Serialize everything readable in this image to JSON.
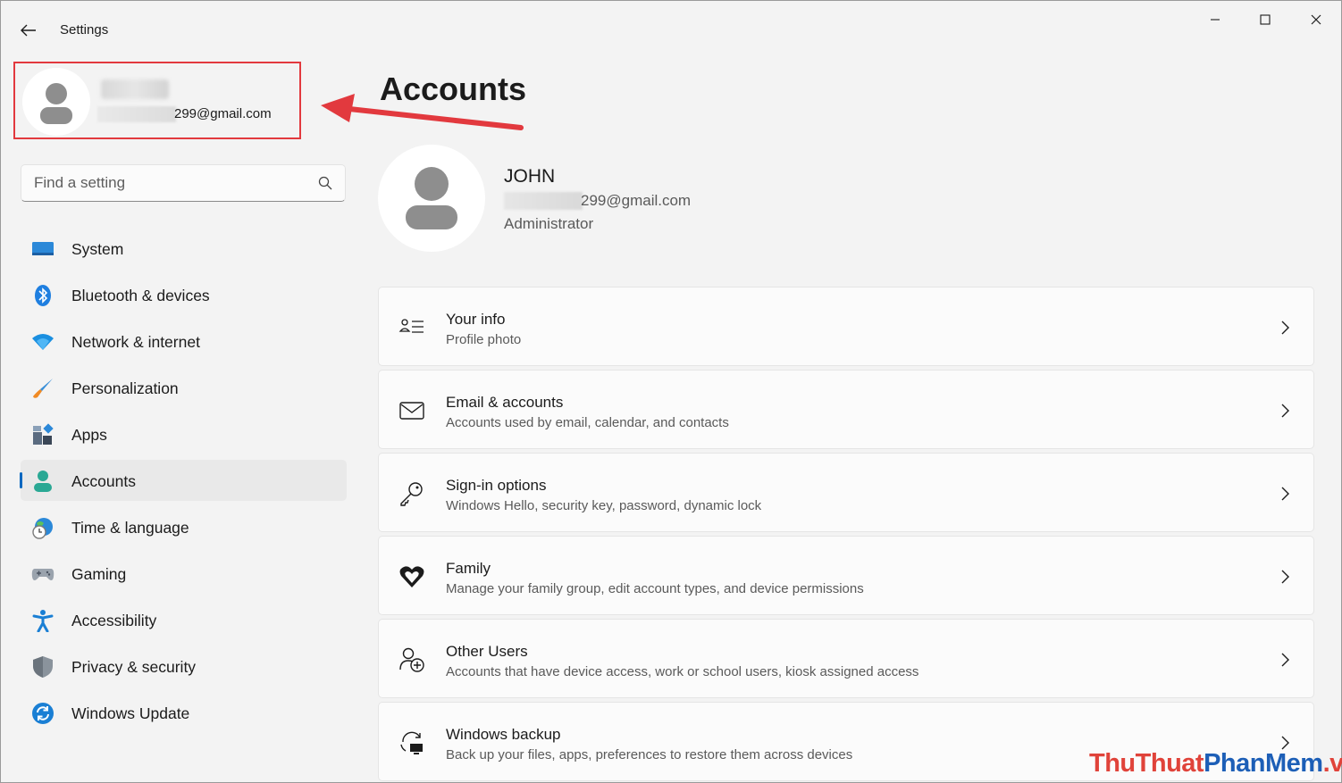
{
  "window": {
    "app_title": "Settings"
  },
  "user_card": {
    "email_visible": "299@gmail.com"
  },
  "search": {
    "placeholder": "Find a setting"
  },
  "sidebar": {
    "items": [
      {
        "label": "System",
        "icon": "system-icon",
        "active": false
      },
      {
        "label": "Bluetooth & devices",
        "icon": "bluetooth-icon",
        "active": false
      },
      {
        "label": "Network & internet",
        "icon": "wifi-icon",
        "active": false
      },
      {
        "label": "Personalization",
        "icon": "brush-icon",
        "active": false
      },
      {
        "label": "Apps",
        "icon": "apps-icon",
        "active": false
      },
      {
        "label": "Accounts",
        "icon": "person-icon",
        "active": true
      },
      {
        "label": "Time & language",
        "icon": "globe-clock-icon",
        "active": false
      },
      {
        "label": "Gaming",
        "icon": "gamepad-icon",
        "active": false
      },
      {
        "label": "Accessibility",
        "icon": "accessibility-icon",
        "active": false
      },
      {
        "label": "Privacy & security",
        "icon": "shield-icon",
        "active": false
      },
      {
        "label": "Windows Update",
        "icon": "update-icon",
        "active": false
      }
    ]
  },
  "main": {
    "title": "Accounts",
    "profile": {
      "name": "JOHN",
      "email_visible": "299@gmail.com",
      "role": "Administrator"
    },
    "cards": [
      {
        "title": "Your info",
        "subtitle": "Profile photo",
        "icon": "contact-card-icon"
      },
      {
        "title": "Email & accounts",
        "subtitle": "Accounts used by email, calendar, and contacts",
        "icon": "mail-icon"
      },
      {
        "title": "Sign-in options",
        "subtitle": "Windows Hello, security key, password, dynamic lock",
        "icon": "key-icon"
      },
      {
        "title": "Family",
        "subtitle": "Manage your family group, edit account types, and device permissions",
        "icon": "family-heart-icon"
      },
      {
        "title": "Other Users",
        "subtitle": "Accounts that have device access, work or school users, kiosk assigned access",
        "icon": "add-person-icon"
      },
      {
        "title": "Windows backup",
        "subtitle": "Back up your files, apps, preferences to restore them across devices",
        "icon": "backup-icon"
      }
    ]
  },
  "watermark": {
    "part1": "ThuThuat",
    "part2": "PhanMem",
    "part3": ".vn"
  },
  "colors": {
    "accent": "#0067c0",
    "highlight_box": "#e2393e",
    "arrow": "#e2393e",
    "background": "#f3f3f3"
  }
}
